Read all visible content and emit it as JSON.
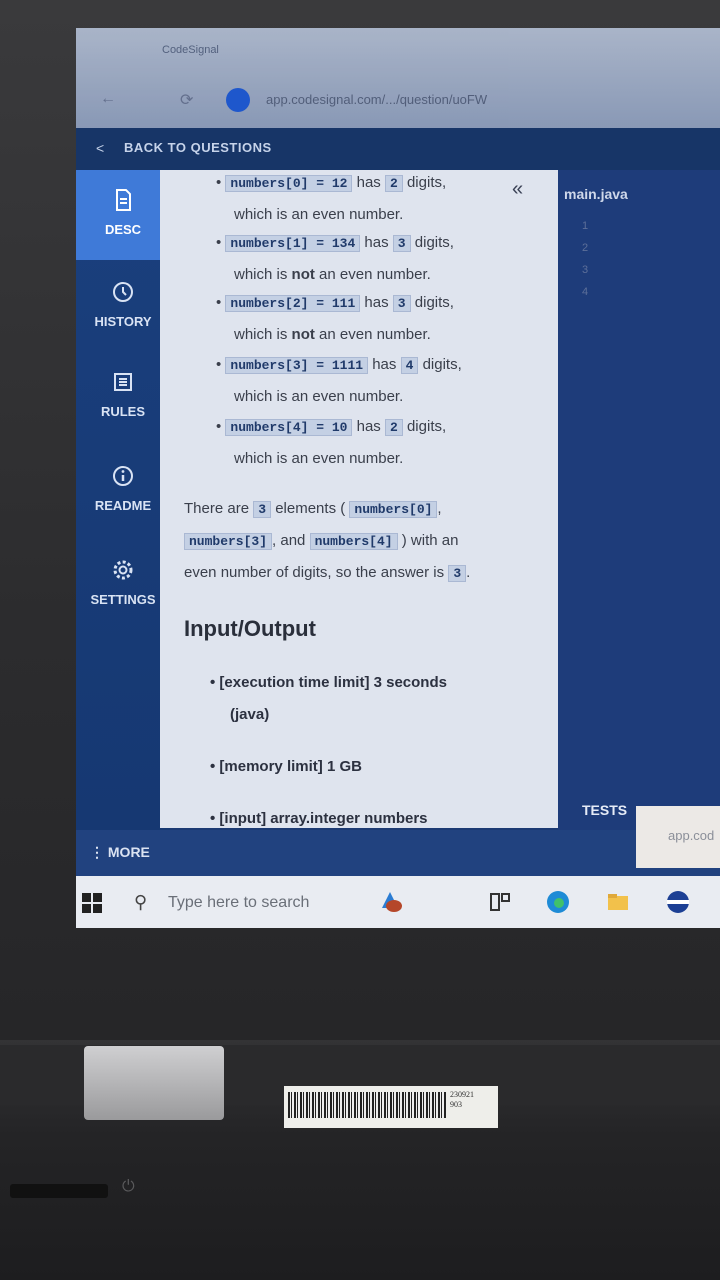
{
  "browser": {
    "tab_title": "CodeSignal",
    "url": "app.codesignal.com/.../question/uoFW"
  },
  "header": {
    "back_label": "BACK TO QUESTIONS"
  },
  "sidebar": {
    "items": [
      {
        "label": "DESC",
        "icon": "document-icon"
      },
      {
        "label": "HISTORY",
        "icon": "clock-icon"
      },
      {
        "label": "RULES",
        "icon": "list-icon"
      },
      {
        "label": "README",
        "icon": "info-icon"
      },
      {
        "label": "SETTINGS",
        "icon": "gear-icon"
      }
    ],
    "more_label": "MORE"
  },
  "description": {
    "bullets": [
      {
        "code": "numbers[0] = 12",
        "mid": "has",
        "count": "2",
        "tail": "digits,",
        "line2_a": "which is an even number.",
        "line2_b": "",
        "line2_c": ""
      },
      {
        "code": "numbers[1] = 134",
        "mid": "has",
        "count": "3",
        "tail": "digits,",
        "line2_a": "which is ",
        "line2_b": "not",
        "line2_c": " an even number."
      },
      {
        "code": "numbers[2] = 111",
        "mid": "has",
        "count": "3",
        "tail": "digits,",
        "line2_a": "which is ",
        "line2_b": "not",
        "line2_c": " an even number."
      },
      {
        "code": "numbers[3] = 1111",
        "mid": "has",
        "count": "4",
        "tail": "digits,",
        "line2_a": "which is an even number.",
        "line2_b": "",
        "line2_c": ""
      },
      {
        "code": "numbers[4] = 10",
        "mid": "has",
        "count": "2",
        "tail": "digits,",
        "line2_a": "which is an even number.",
        "line2_b": "",
        "line2_c": ""
      }
    ],
    "summary": {
      "p1": "There are",
      "c1": "3",
      "p2": "elements (",
      "c2": "numbers[0]",
      "p3": ",",
      "c3": "numbers[3]",
      "p4": ", and",
      "c4": "numbers[4]",
      "p5": ") with an",
      "p6": "even number of digits, so the answer is",
      "c5": "3",
      "p7": "."
    },
    "io_title": "Input/Output",
    "io_items": [
      "[execution time limit] 3 seconds",
      "(java)",
      "[memory limit] 1 GB",
      "[input] array.integer numbers"
    ]
  },
  "editor": {
    "tab": "main.java",
    "line_numbers": [
      "1",
      "2",
      "3",
      "4"
    ],
    "tests_label": "TESTS"
  },
  "toast": {
    "text": "app.cod"
  },
  "taskbar": {
    "search_placeholder": "Type here to search"
  },
  "device": {
    "asset_label": "230921\n903"
  }
}
